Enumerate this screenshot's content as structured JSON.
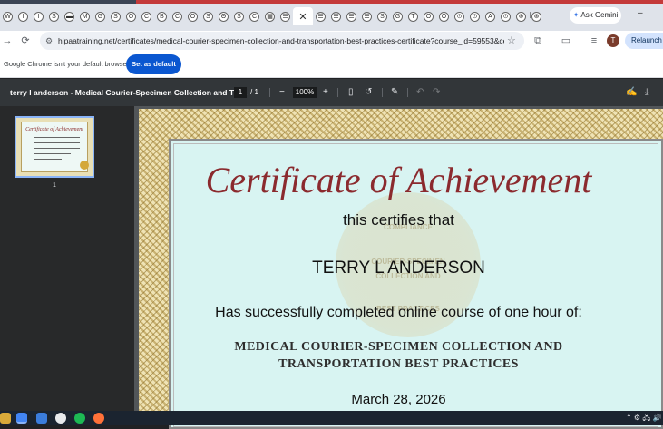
{
  "browser": {
    "tabs": {
      "favicons": [
        "W",
        "I",
        "I",
        "S",
        "▬",
        "M",
        "G",
        "S",
        "O",
        "C",
        "B",
        "C",
        "O",
        "S",
        "Θ",
        "S",
        "C",
        "▦",
        "☰"
      ],
      "trailing_favicons": [
        "☰",
        "☰",
        "☰",
        "☰",
        "S",
        "G",
        "T",
        "O",
        "O",
        "⊙",
        "⊙",
        "A",
        "⊙",
        "⊛",
        "⊛"
      ],
      "active_close": "✕",
      "new_tab": "+"
    },
    "ask_gemini": "Ask Gemini",
    "window_min": "–",
    "url": "hipaatraining.net/certificates/medical-courier-specimen-collection-and-transportation-best-practices-certificate?course_id=59553&cert...",
    "avatar_letter": "T",
    "relaunch": "Relaunch to",
    "infobar": {
      "message": "Google Chrome isn't your default browser",
      "button": "Set as default"
    }
  },
  "pdf_viewer": {
    "title": "terry l anderson - Medical Courier-Specimen Collection and Tra...",
    "page_current": "1",
    "page_sep": "/",
    "page_total": "1",
    "zoom": "100%",
    "thumbnail_label": "1"
  },
  "certificate": {
    "heading": "Certificate of Achievement",
    "certifies": "this certifies that",
    "name": "TERRY L ANDERSON",
    "completion": "Has successfully completed online course of one hour of:",
    "course_line1": "MEDICAL COURIER-SPECIMEN COLLECTION AND",
    "course_line2": "TRANSPORTATION BEST PRACTICES",
    "date": "March 28, 2026",
    "watermark_lines": [
      "COMPLIANCE",
      "COURIER-SPECIMEN",
      "COLLECTION AND",
      "BEST PRACTICES"
    ],
    "thumb_heading": "Certificate of Achievement",
    "colors": {
      "heading": "#8b2a2e",
      "background": "#d8f4f2"
    }
  }
}
